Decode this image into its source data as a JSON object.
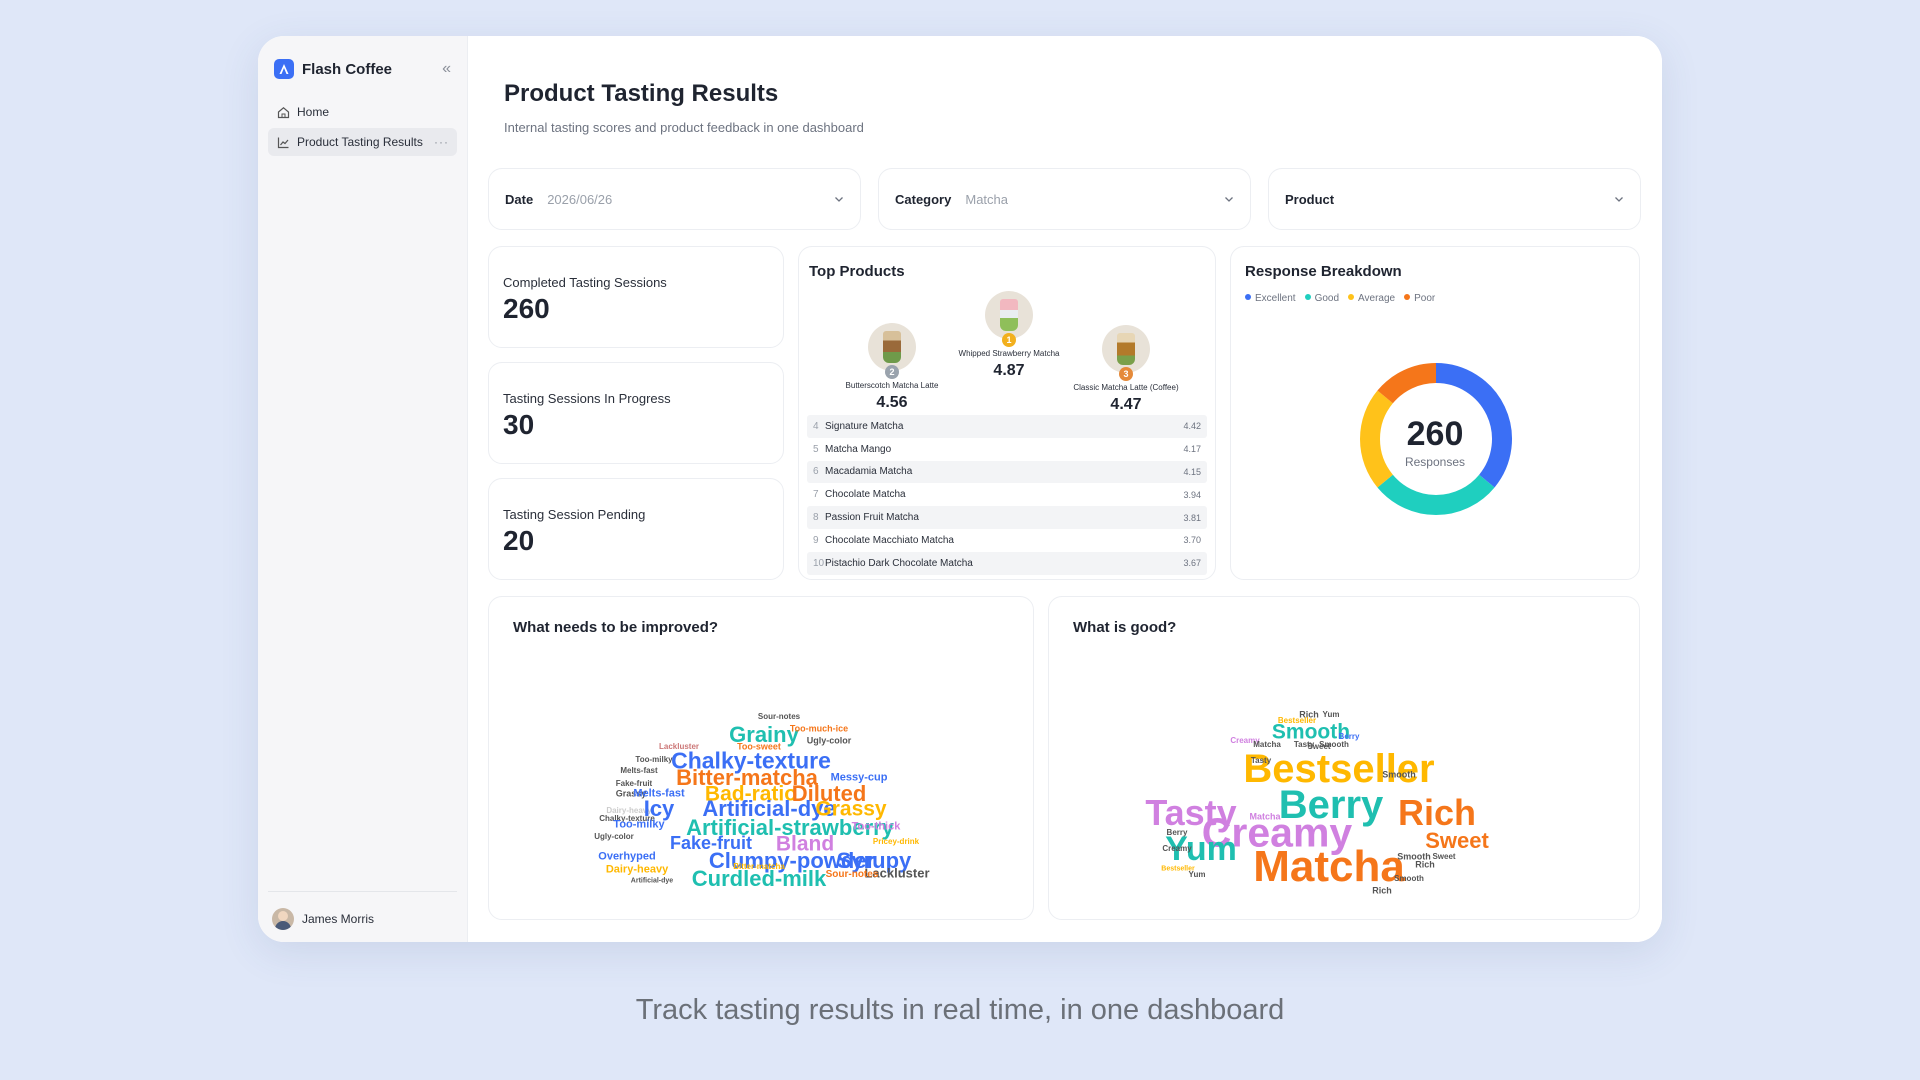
{
  "app": {
    "name": "Flash Coffee",
    "nav": [
      {
        "label": "Home",
        "icon": "home-icon"
      },
      {
        "label": "Product Tasting Results",
        "icon": "chart-icon",
        "active": true
      }
    ],
    "user": "James Morris"
  },
  "page": {
    "title": "Product Tasting Results",
    "subtitle": "Internal tasting scores and product feedback in one dashboard"
  },
  "filters": {
    "date": {
      "label": "Date",
      "value": "2026/06/26"
    },
    "category": {
      "label": "Category",
      "value": "Matcha"
    },
    "product": {
      "label": "Product",
      "value": ""
    }
  },
  "stats": [
    {
      "label": "Completed Tasting Sessions",
      "value": "260"
    },
    {
      "label": "Tasting Sessions In Progress",
      "value": "30"
    },
    {
      "label": "Tasting Session Pending",
      "value": "20"
    }
  ],
  "top_products": {
    "title": "Top Products",
    "podium": [
      {
        "rank": "1",
        "name": "Whipped Strawberry Matcha",
        "score": "4.87"
      },
      {
        "rank": "2",
        "name": "Butterscotch Matcha Latte",
        "score": "4.56"
      },
      {
        "rank": "3",
        "name": "Classic Matcha Latte (Coffee)",
        "score": "4.47"
      }
    ],
    "list": [
      {
        "rank": "4",
        "name": "Signature Matcha",
        "score": "4.42"
      },
      {
        "rank": "5",
        "name": "Matcha Mango",
        "score": "4.17"
      },
      {
        "rank": "6",
        "name": "Macadamia Matcha",
        "score": "4.15"
      },
      {
        "rank": "7",
        "name": "Chocolate Matcha",
        "score": "3.94"
      },
      {
        "rank": "8",
        "name": "Passion Fruit Matcha",
        "score": "3.81"
      },
      {
        "rank": "9",
        "name": "Chocolate Macchiato Matcha",
        "score": "3.70"
      },
      {
        "rank": "10",
        "name": "Pistachio Dark Chocolate Matcha",
        "score": "3.67"
      }
    ]
  },
  "response_breakdown": {
    "title": "Response Breakdown",
    "total": "260",
    "total_label": "Responses",
    "legend": [
      {
        "label": "Excellent",
        "color": "#3b6ff5"
      },
      {
        "label": "Good",
        "color": "#1fcfbf"
      },
      {
        "label": "Average",
        "color": "#ffc21a"
      },
      {
        "label": "Poor",
        "color": "#f5761a"
      }
    ]
  },
  "chart_data": {
    "type": "pie",
    "categories": [
      "Excellent",
      "Good",
      "Average",
      "Poor"
    ],
    "values": [
      36,
      28,
      22,
      14
    ],
    "colors": [
      "#3b6ff5",
      "#1fcfbf",
      "#ffc21a",
      "#f5761a"
    ],
    "legend": "top-left"
  },
  "improve": {
    "title": "What needs to be improved?",
    "words": [
      {
        "t": "Sour-notes",
        "s": 8,
        "c": "#555"
      },
      {
        "t": "Grainy",
        "s": 22,
        "c": "#1fbfb0"
      },
      {
        "t": "Too-much-ice",
        "s": 9,
        "c": "#f5761a"
      },
      {
        "t": "Ugly-color",
        "s": 9,
        "c": "#555"
      },
      {
        "t": "Lackluster",
        "s": 8,
        "c": "#c77"
      },
      {
        "t": "Too-sweet",
        "s": 9,
        "c": "#f5761a"
      },
      {
        "t": "Too-milky",
        "s": 8,
        "c": "#555"
      },
      {
        "t": "Chalky-texture",
        "s": 23,
        "c": "#3b6ff5"
      },
      {
        "t": "Melts-fast",
        "s": 8,
        "c": "#555"
      },
      {
        "t": "Bitter-matcha",
        "s": 22,
        "c": "#f5761a"
      },
      {
        "t": "Messy-cup",
        "s": 11,
        "c": "#3b6ff5"
      },
      {
        "t": "Fake-fruit",
        "s": 8,
        "c": "#555"
      },
      {
        "t": "Grassy",
        "s": 9,
        "c": "#555"
      },
      {
        "t": "Bad-ratio",
        "s": 21,
        "c": "#ffb800"
      },
      {
        "t": "Diluted",
        "s": 22,
        "c": "#f5761a"
      },
      {
        "t": "Melts-fast",
        "s": 11,
        "c": "#3b6ff5"
      },
      {
        "t": "Dairy-heavy",
        "s": 8,
        "c": "#ccc"
      },
      {
        "t": "Icy",
        "s": 22,
        "c": "#3b6ff5"
      },
      {
        "t": "Artificial-dye",
        "s": 22,
        "c": "#3b6ff5"
      },
      {
        "t": "Grassy",
        "s": 21,
        "c": "#ffb800"
      },
      {
        "t": "Chalky-texture",
        "s": 8,
        "c": "#555"
      },
      {
        "t": "Too-milky",
        "s": 11,
        "c": "#3b6ff5"
      },
      {
        "t": "Artificial-strawberry",
        "s": 22,
        "c": "#1fbfb0"
      },
      {
        "t": "Too-thick",
        "s": 11,
        "c": "#d080e0"
      },
      {
        "t": "Ugly-color",
        "s": 8,
        "c": "#555"
      },
      {
        "t": "Fake-fruit",
        "s": 18,
        "c": "#3b6ff5"
      },
      {
        "t": "Bland",
        "s": 21,
        "c": "#d080e0"
      },
      {
        "t": "Pricey-drink",
        "s": 8,
        "c": "#ffb800"
      },
      {
        "t": "Overhyped",
        "s": 11,
        "c": "#3b6ff5"
      },
      {
        "t": "Clumpy-powder",
        "s": 22,
        "c": "#3b6ff5"
      },
      {
        "t": "Syrupy",
        "s": 22,
        "c": "#3b6ff5"
      },
      {
        "t": "Dairy-heavy",
        "s": 11,
        "c": "#ffb800"
      },
      {
        "t": "Lackluster",
        "s": 13,
        "c": "#555"
      },
      {
        "t": "Curdled-milk",
        "s": 22,
        "c": "#1fbfb0"
      },
      {
        "t": "Sour-notes",
        "s": 10,
        "c": "#f5761a"
      },
      {
        "t": "Bitter-matcha",
        "s": 8,
        "c": "#ffb800"
      },
      {
        "t": "Artificial-dye",
        "s": 7,
        "c": "#555"
      }
    ]
  },
  "good": {
    "title": "What is good?",
    "words": [
      {
        "t": "Rich",
        "s": 9,
        "c": "#555"
      },
      {
        "t": "Yum",
        "s": 8,
        "c": "#555"
      },
      {
        "t": "Bestseller",
        "s": 8,
        "c": "#ffb800"
      },
      {
        "t": "Smooth",
        "s": 21,
        "c": "#1fbfb0"
      },
      {
        "t": "Berry",
        "s": 8,
        "c": "#3b6ff5"
      },
      {
        "t": "Creamy",
        "s": 8,
        "c": "#d080e0"
      },
      {
        "t": "Matcha",
        "s": 8,
        "c": "#555"
      },
      {
        "t": "Tasty",
        "s": 8,
        "c": "#555"
      },
      {
        "t": "Sweet",
        "s": 8,
        "c": "#555"
      },
      {
        "t": "Smooth",
        "s": 8,
        "c": "#555"
      },
      {
        "t": "Bestseller",
        "s": 40,
        "c": "#ffb800"
      },
      {
        "t": "Smooth",
        "s": 9,
        "c": "#555"
      },
      {
        "t": "Tasty",
        "s": 8,
        "c": "#555"
      },
      {
        "t": "Tasty",
        "s": 36,
        "c": "#d080e0"
      },
      {
        "t": "Berry",
        "s": 40,
        "c": "#1fbfb0"
      },
      {
        "t": "Rich",
        "s": 36,
        "c": "#f5761a"
      },
      {
        "t": "Matcha",
        "s": 9,
        "c": "#d080e0"
      },
      {
        "t": "Creamy",
        "s": 41,
        "c": "#d080e0"
      },
      {
        "t": "Sweet",
        "s": 22,
        "c": "#f5761a"
      },
      {
        "t": "Yum",
        "s": 34,
        "c": "#1fbfb0"
      },
      {
        "t": "Matcha",
        "s": 44,
        "c": "#f5761a"
      },
      {
        "t": "Smooth",
        "s": 9,
        "c": "#555"
      },
      {
        "t": "Rich",
        "s": 9,
        "c": "#555"
      },
      {
        "t": "Berry",
        "s": 8,
        "c": "#555"
      },
      {
        "t": "Bestseller",
        "s": 7,
        "c": "#ffb800"
      },
      {
        "t": "Yum",
        "s": 8,
        "c": "#555"
      },
      {
        "t": "Creamy",
        "s": 8,
        "c": "#555"
      },
      {
        "t": "Smooth",
        "s": 8,
        "c": "#555"
      },
      {
        "t": "Sweet",
        "s": 8,
        "c": "#555"
      },
      {
        "t": "Rich",
        "s": 9,
        "c": "#555"
      }
    ]
  },
  "caption": "Track tasting results in real time, in one dashboard"
}
